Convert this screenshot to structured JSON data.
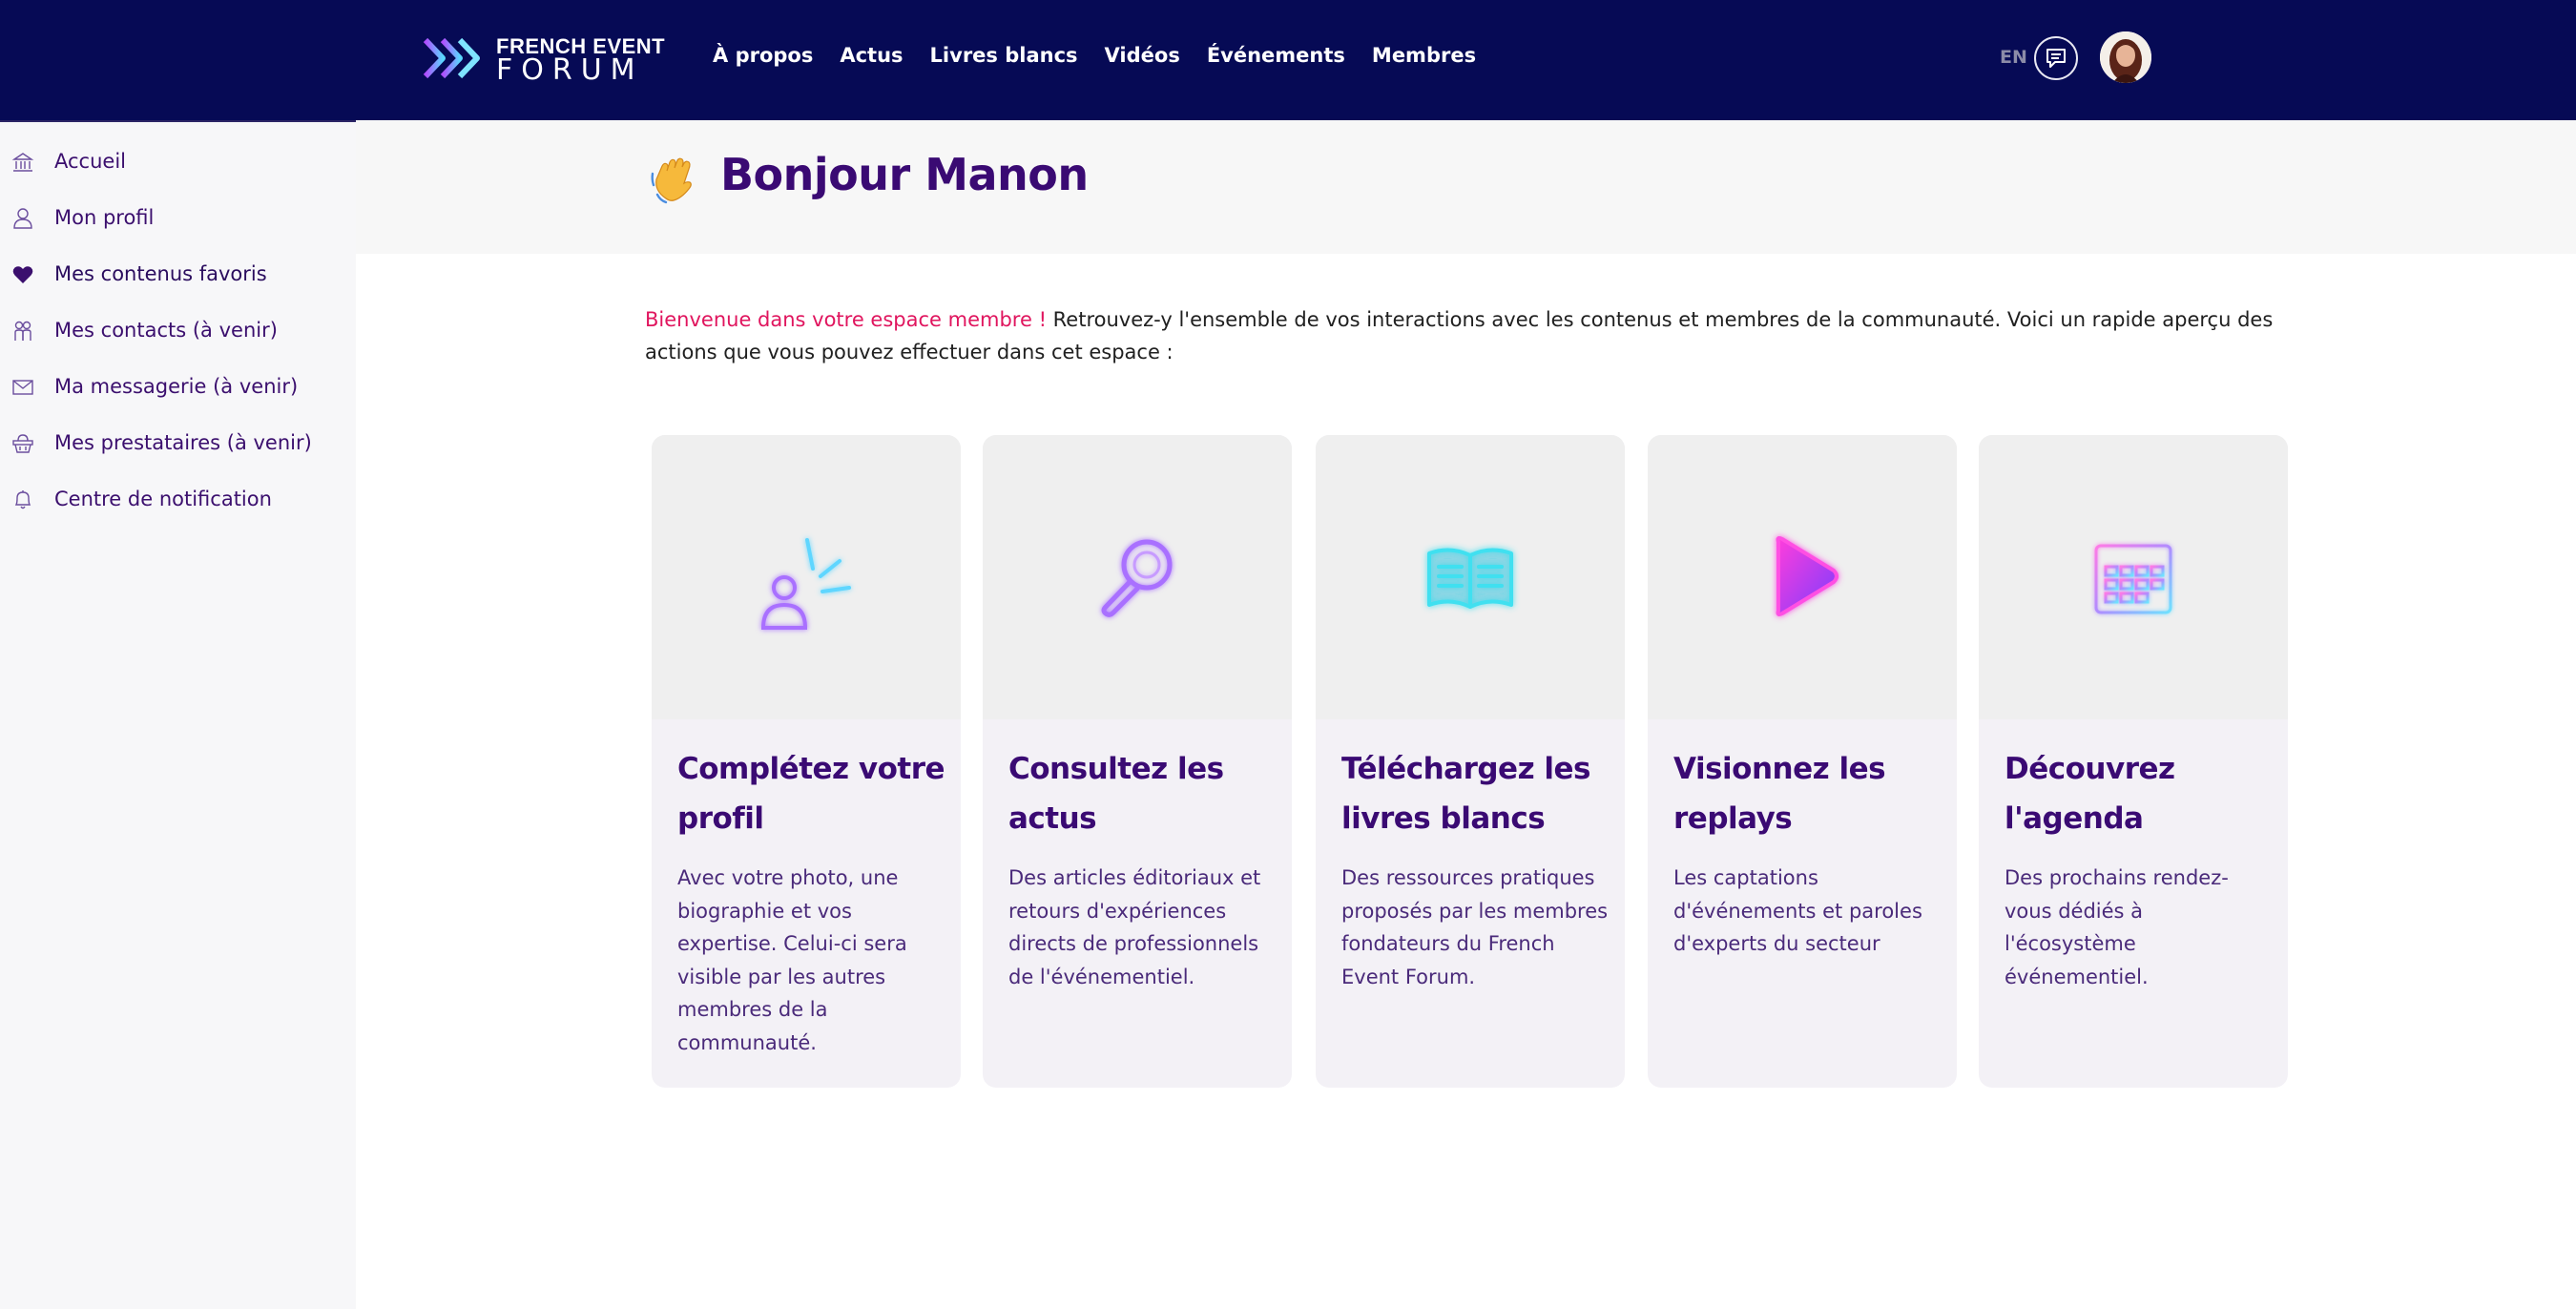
{
  "header": {
    "logo_line1": "FRENCH EVENT",
    "logo_line2": "FORUM",
    "nav": [
      "À propos",
      "Actus",
      "Livres blancs",
      "Vidéos",
      "Événements",
      "Membres"
    ],
    "lang": "EN"
  },
  "sidebar": {
    "items": [
      {
        "label": "Accueil",
        "icon": "home-icon"
      },
      {
        "label": "Mon profil",
        "icon": "user-icon"
      },
      {
        "label": "Mes contenus favoris",
        "icon": "heart-icon"
      },
      {
        "label": "Mes contacts (à venir)",
        "icon": "contacts-icon"
      },
      {
        "label": "Ma messagerie (à venir)",
        "icon": "envelope-icon"
      },
      {
        "label": "Mes prestataires (à venir)",
        "icon": "basket-icon"
      },
      {
        "label": "Centre de notification",
        "icon": "bell-icon"
      }
    ]
  },
  "main": {
    "greeting": "Bonjour Manon",
    "intro_accent": "Bienvenue dans votre espace membre !",
    "intro_text": " Retrouvez-y l'ensemble de vos interactions avec les contenus et membres de la communauté. Voici un rapide aperçu des actions que vous pouvez effectuer dans cet espace :",
    "cards": [
      {
        "title": "Complétez votre profil",
        "desc": "Avec votre photo, une biographie et vos expertise. Celui-ci sera visible par les autres membres de la communauté.",
        "icon": "profile-neon-icon"
      },
      {
        "title": "Consultez les actus",
        "desc": "Des articles éditoriaux et retours d'expériences directs de professionnels de l'événementiel.",
        "icon": "magnifier-neon-icon"
      },
      {
        "title": "Téléchargez les livres blancs",
        "desc": "Des ressources pratiques proposés par les membres fondateurs du French Event Forum.",
        "icon": "book-neon-icon"
      },
      {
        "title": "Visionnez les replays",
        "desc": "Les captations d'événements et paroles d'experts du secteur",
        "icon": "play-neon-icon"
      },
      {
        "title": "Découvrez l'agenda",
        "desc": "Des prochains rendez-vous dédiés à l'écosystème événementiel.",
        "icon": "calendar-neon-icon"
      }
    ]
  },
  "colors": {
    "topbar": "#060a55",
    "title": "#3a0a73",
    "accent": "#e0155e",
    "sidebar_bg": "#f7f7f9",
    "card_bg": "#f3f1f6"
  }
}
